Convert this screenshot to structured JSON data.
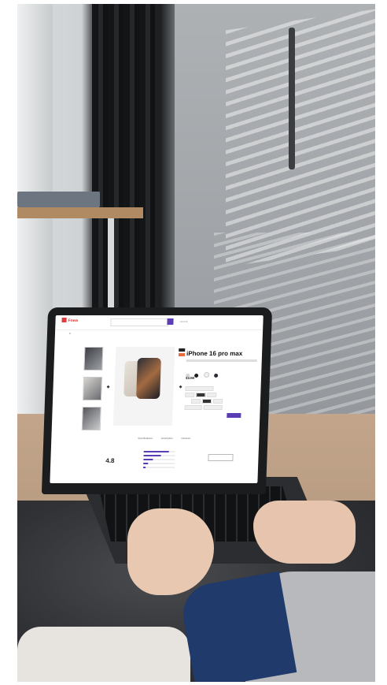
{
  "screen": {
    "title": "iPhone 16 pro max",
    "price": "$1099",
    "rating": "4.8",
    "logo": "Fnew",
    "tabs": [
      "Specifications",
      "Description",
      "Reviews"
    ]
  },
  "colors": {
    "accent": "#5b3db5",
    "logo": "#e23b3b",
    "swatches": [
      "#d8d4cf",
      "#1d1d1f",
      "#f1f0ee",
      "#2a2d35"
    ]
  }
}
